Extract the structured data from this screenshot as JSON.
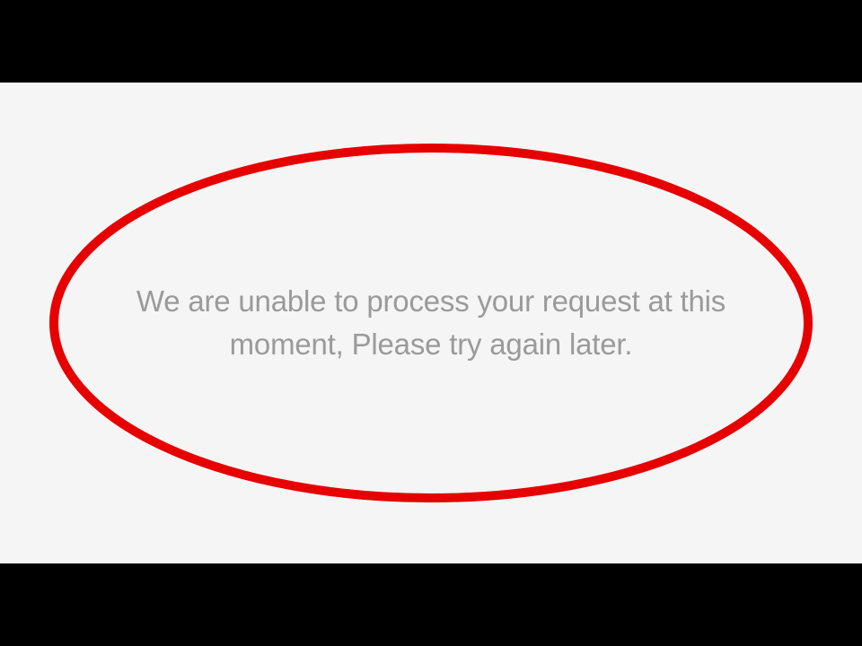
{
  "letterbox": {
    "color": "#000000"
  },
  "content": {
    "background": "#f5f5f5"
  },
  "error": {
    "message": "We are unable to process your request at this moment, Please try again later."
  },
  "annotation": {
    "stroke_color": "#e60000",
    "stroke_width": 10
  }
}
